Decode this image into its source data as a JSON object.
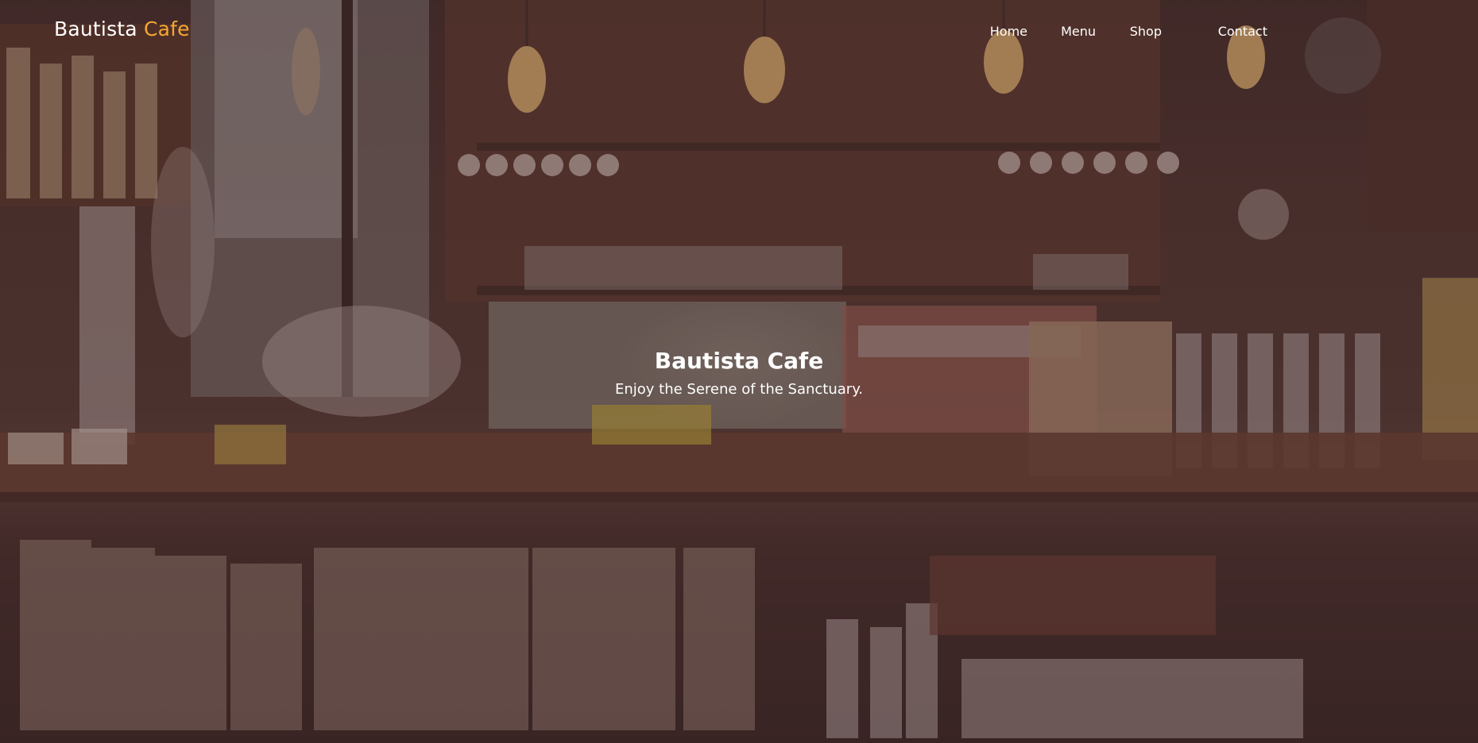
{
  "header": {
    "brand_primary": "Bautista",
    "brand_accent": "Cafe",
    "nav": [
      {
        "label": "Home"
      },
      {
        "label": "Menu"
      },
      {
        "label": "Shop"
      },
      {
        "label": "Contact"
      }
    ]
  },
  "hero": {
    "title": "Bautista Cafe",
    "subtitle": "Enjoy the Serene of the Sanctuary.",
    "background_image": "cafe-interior-photo"
  },
  "colors": {
    "accent": "#f5a732",
    "text": "#ffffff",
    "overlay": "#46282d"
  }
}
